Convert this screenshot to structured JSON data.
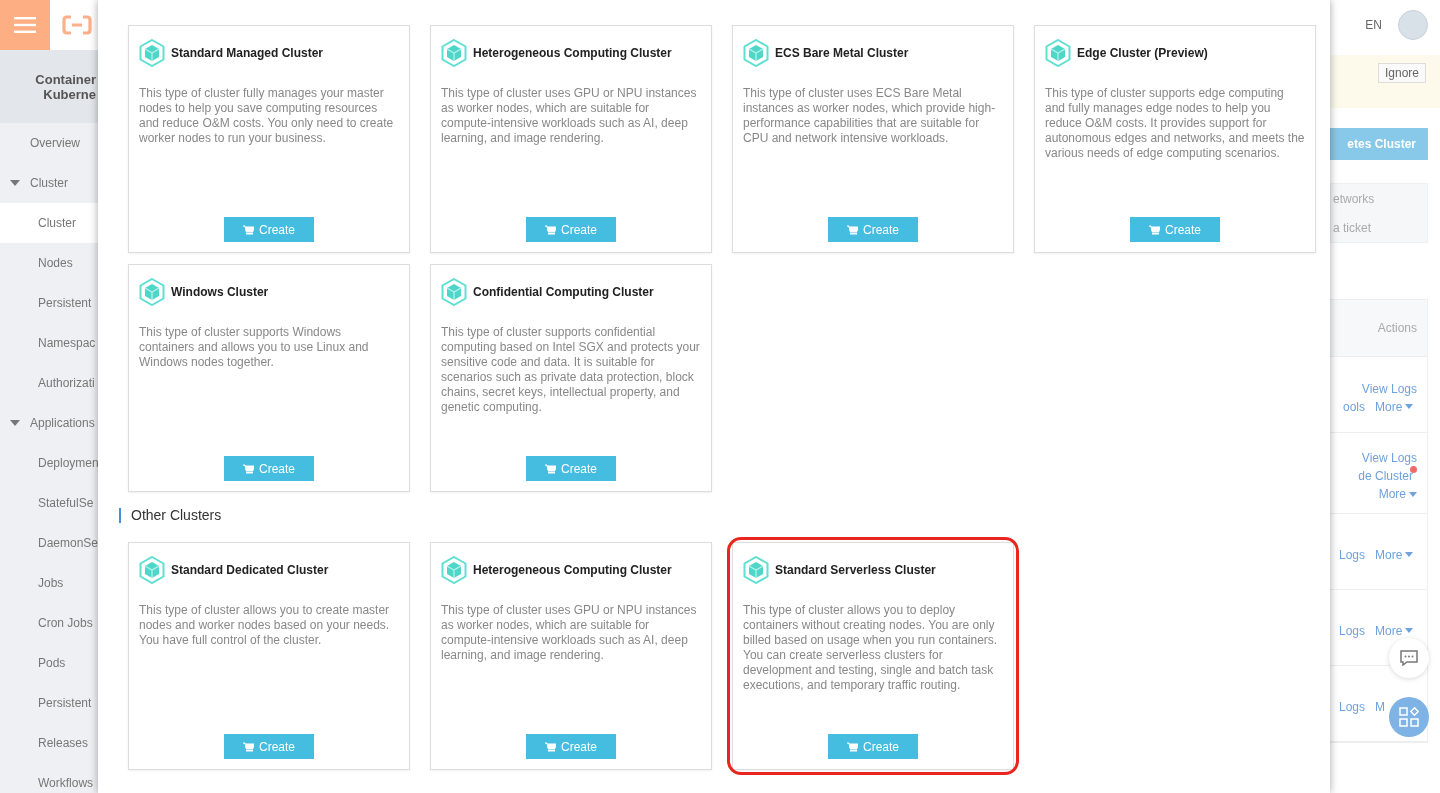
{
  "topbar": {
    "language": "EN"
  },
  "sidebar": {
    "title_lines": [
      "Container",
      "Kuberne"
    ],
    "items": [
      {
        "label": "Overview",
        "selected": false
      },
      {
        "label": "Cluster",
        "selected": false,
        "expanded": true,
        "children": [
          {
            "label": "Cluster",
            "selected": true
          },
          {
            "label": "Nodes",
            "selected": false
          },
          {
            "label": "Persistent",
            "selected": false
          },
          {
            "label": "Namespac",
            "selected": false
          },
          {
            "label": "Authorizati",
            "selected": false
          }
        ]
      },
      {
        "label": "Applications",
        "selected": false,
        "expanded": true,
        "children": [
          {
            "label": "Deploymen",
            "selected": false
          },
          {
            "label": "StatefulSe",
            "selected": false
          },
          {
            "label": "DaemonSe",
            "selected": false
          },
          {
            "label": "Jobs",
            "selected": false
          },
          {
            "label": "Cron Jobs",
            "selected": false
          },
          {
            "label": "Pods",
            "selected": false
          },
          {
            "label": "Persistent",
            "selected": false
          },
          {
            "label": "Releases",
            "selected": false
          },
          {
            "label": "Workflows",
            "selected": false
          }
        ]
      }
    ]
  },
  "modal": {
    "sections": [
      {
        "clusters": [
          {
            "name": "Standard Managed Cluster",
            "description": "This type of cluster fully manages your master nodes to help you save computing resources and reduce O&M costs. You only need to create worker nodes to run your business.",
            "button": "Create",
            "highlighted": false
          },
          {
            "name": "Heterogeneous Computing Cluster",
            "description": "This type of cluster uses GPU or NPU instances as worker nodes, which are suitable for compute-intensive workloads such as AI, deep learning, and image rendering.",
            "button": "Create",
            "highlighted": false
          },
          {
            "name": "ECS Bare Metal Cluster",
            "description": "This type of cluster uses ECS Bare Metal instances as worker nodes, which provide high-performance capabilities that are suitable for CPU and network intensive workloads.",
            "button": "Create",
            "highlighted": false
          },
          {
            "name": "Edge Cluster (Preview)",
            "description": "This type of cluster supports edge computing and fully manages edge nodes to help you reduce O&M costs. It provides support for autonomous edges and networks, and meets the various needs of edge computing scenarios.",
            "button": "Create",
            "highlighted": false
          },
          {
            "name": "Windows Cluster",
            "description": "This type of cluster supports Windows containers and allows you to use Linux and Windows nodes together.",
            "button": "Create",
            "highlighted": false
          },
          {
            "name": "Confidential Computing Cluster",
            "description": "This type of cluster supports confidential computing based on Intel SGX and protects your sensitive code and data. It is suitable for scenarios such as private data protection, block chains, secret keys, intellectual property, and genetic computing.",
            "button": "Create",
            "highlighted": false
          }
        ]
      },
      {
        "title": "Other Clusters",
        "clusters": [
          {
            "name": "Standard Dedicated Cluster",
            "description": "This type of cluster allows you to create master nodes and worker nodes based on your needs. You have full control of the cluster.",
            "button": "Create",
            "highlighted": false
          },
          {
            "name": "Heterogeneous Computing Cluster",
            "description": "This type of cluster uses GPU or NPU instances as worker nodes, which are suitable for compute-intensive workloads such as AI, deep learning, and image rendering.",
            "button": "Create",
            "highlighted": false
          },
          {
            "name": "Standard Serverless Cluster",
            "description": "This type of cluster allows you to deploy containers without creating nodes. You are only billed based on usage when you run containers. You can create serverless clusters for development and testing, single and batch task executions, and temporary traffic routing.",
            "button": "Create",
            "highlighted": true
          }
        ]
      }
    ]
  },
  "background": {
    "notice_button": "Ignore",
    "primary_button": "etes Cluster",
    "help_links": [
      "etworks",
      "a ticket"
    ],
    "table": {
      "header": "Actions",
      "rows": [
        {
          "lines": [
            [
              {
                "label": "View Logs",
                "kind": "link",
                "notified": false
              }
            ],
            [
              {
                "label": "ools",
                "kind": "link",
                "notified": false
              },
              {
                "label": "More",
                "kind": "menu",
                "notified": false
              }
            ]
          ]
        },
        {
          "lines": [
            [
              {
                "label": "View Logs",
                "kind": "link",
                "notified": false
              }
            ],
            [
              {
                "label": "de Cluster",
                "kind": "link",
                "notified": true
              }
            ],
            [
              {
                "label": "More",
                "kind": "menu",
                "notified": false
              }
            ]
          ]
        },
        {
          "lines": [
            [
              {
                "label": "Logs",
                "kind": "link",
                "notified": false
              },
              {
                "label": "More",
                "kind": "menu",
                "notified": false
              }
            ]
          ]
        },
        {
          "lines": [
            [
              {
                "label": "Logs",
                "kind": "link",
                "notified": false
              },
              {
                "label": "More",
                "kind": "menu",
                "notified": false
              }
            ]
          ]
        },
        {
          "lines": [
            [
              {
                "label": "Logs",
                "kind": "link",
                "notified": false
              },
              {
                "label": "M",
                "kind": "link",
                "notified": false
              }
            ]
          ]
        }
      ]
    }
  }
}
